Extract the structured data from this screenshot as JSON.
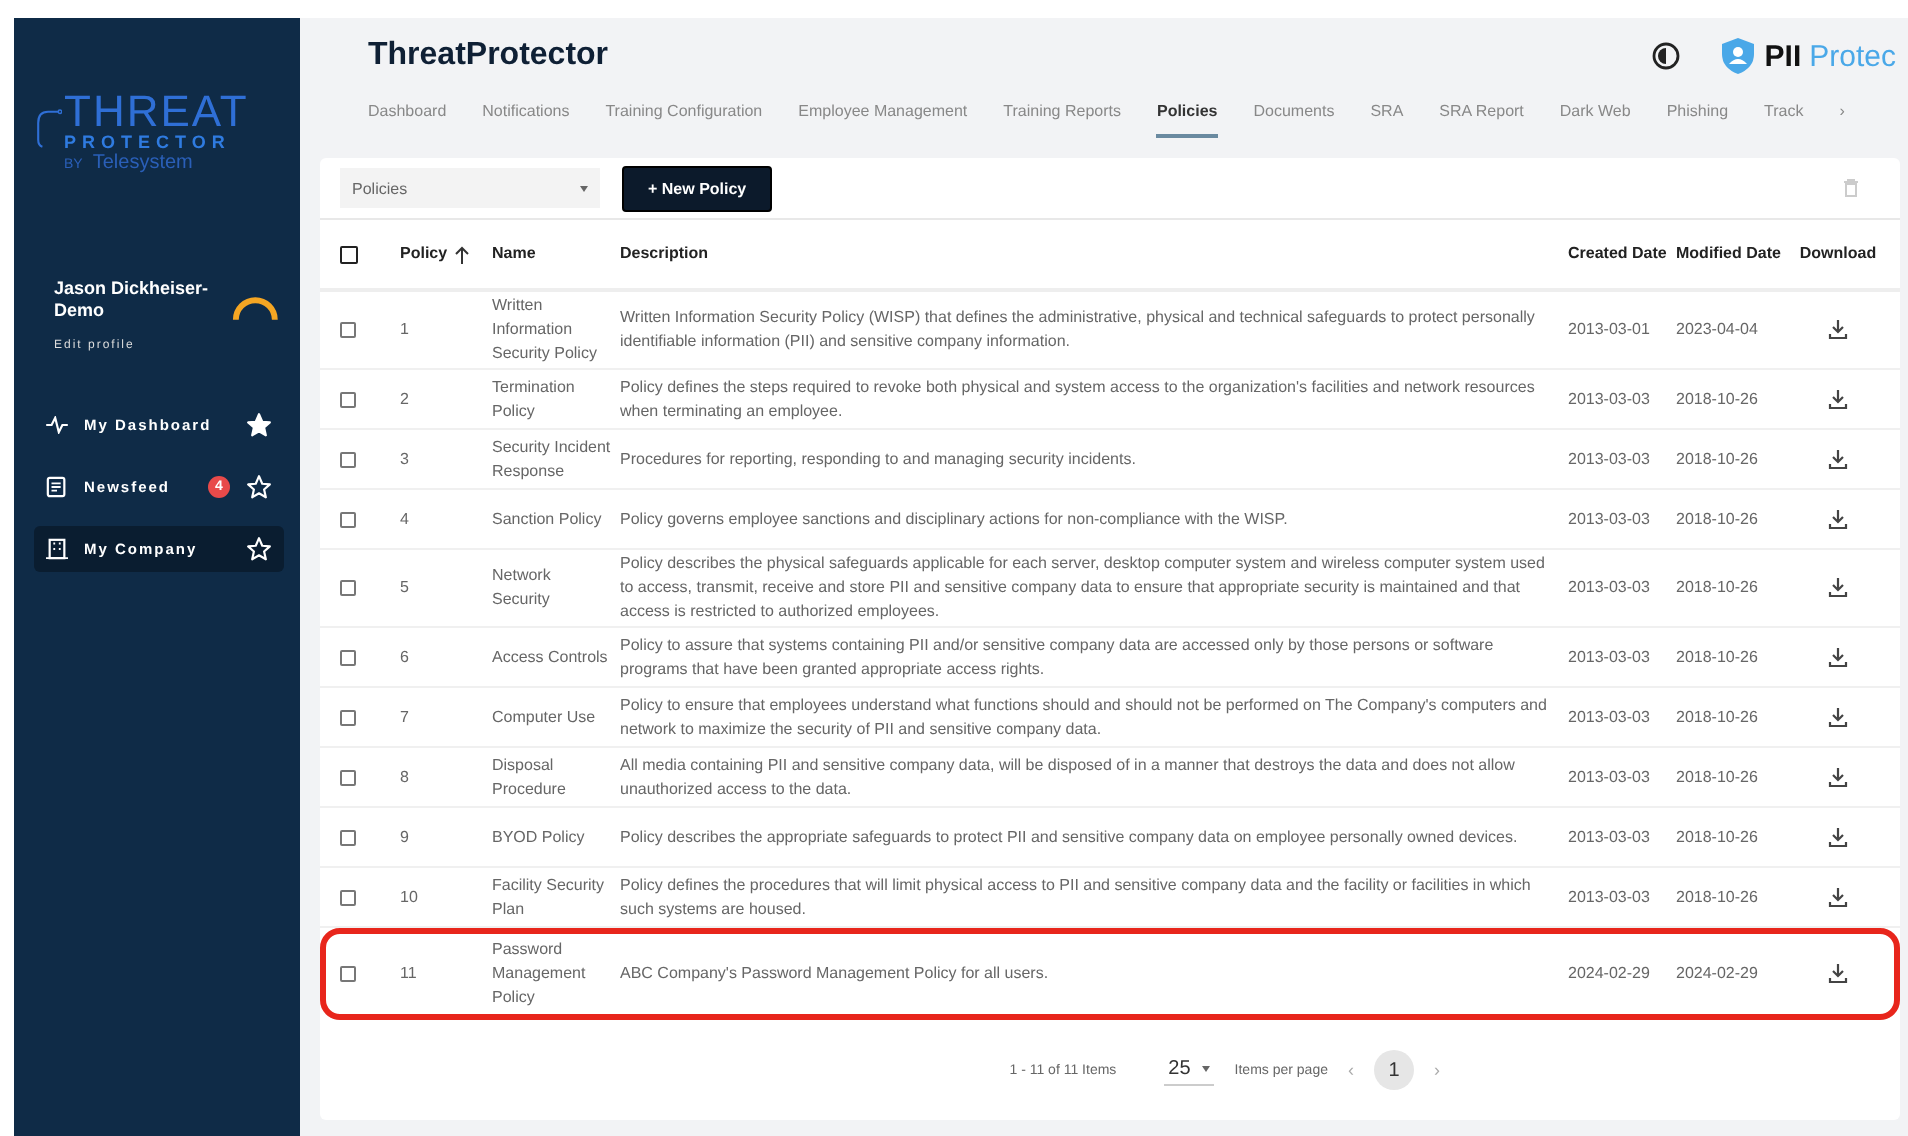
{
  "logo": {
    "line1": "THREAT",
    "line2": "PROTECTOR",
    "by": "BY",
    "brand": "Telesystem"
  },
  "user": {
    "name": "Jason Dickheiser-Demo",
    "edit": "Edit profile"
  },
  "nav": [
    {
      "label": "My Dashboard",
      "kind": "pulse",
      "selected": false,
      "starred": true
    },
    {
      "label": "Newsfeed",
      "kind": "news",
      "badge": "4",
      "selected": false,
      "starred": false
    },
    {
      "label": "My Company",
      "kind": "building",
      "selected": true,
      "starred": false
    }
  ],
  "header": {
    "title": "ThreatProtector",
    "brand_a": "PII",
    "brand_b": "Protec"
  },
  "tabs": [
    {
      "label": "Dashboard",
      "selected": false
    },
    {
      "label": "Notifications",
      "selected": false
    },
    {
      "label": "Training Configuration",
      "selected": false
    },
    {
      "label": "Employee Management",
      "selected": false
    },
    {
      "label": "Training Reports",
      "selected": false
    },
    {
      "label": "Policies",
      "selected": true
    },
    {
      "label": "Documents",
      "selected": false
    },
    {
      "label": "SRA",
      "selected": false
    },
    {
      "label": "SRA Report",
      "selected": false
    },
    {
      "label": "Dark Web",
      "selected": false
    },
    {
      "label": "Phishing",
      "selected": false
    },
    {
      "label": "Track",
      "selected": false
    }
  ],
  "tabs_more": "›",
  "toolbar": {
    "dropdown": "Policies",
    "new_button": "+ New Policy"
  },
  "table": {
    "all_checked": false,
    "columns": [
      "Policy",
      "Name",
      "Description",
      "Created Date",
      "Modified Date",
      "Download"
    ],
    "rows": [
      {
        "policy": "1",
        "name": "Written Information Security Policy",
        "description": "Written Information Security Policy (WISP) that defines the administrative, physical and technical safeguards to protect personally identifiable information (PII) and sensitive company information.",
        "created": "2013-03-01",
        "modified": "2023-04-04",
        "checked": false,
        "highlighted": false
      },
      {
        "policy": "2",
        "name": "Termination Policy",
        "description": "Policy defines the steps required to revoke both physical and system access to the organization's facilities and network resources when terminating an employee.",
        "created": "2013-03-03",
        "modified": "2018-10-26",
        "checked": false,
        "highlighted": false
      },
      {
        "policy": "3",
        "name": "Security Incident Response",
        "description": "Procedures for reporting, responding to and managing security incidents.",
        "created": "2013-03-03",
        "modified": "2018-10-26",
        "checked": false,
        "highlighted": false
      },
      {
        "policy": "4",
        "name": "Sanction Policy",
        "description": "Policy governs employee sanctions and disciplinary actions for non-compliance with the WISP.",
        "created": "2013-03-03",
        "modified": "2018-10-26",
        "checked": false,
        "highlighted": false
      },
      {
        "policy": "5",
        "name": "Network Security",
        "description": "Policy describes the physical safeguards applicable for each server, desktop computer system and wireless computer system used to access, transmit, receive and store PII and sensitive company data to ensure that appropriate security is maintained and that access is restricted to authorized employees.",
        "created": "2013-03-03",
        "modified": "2018-10-26",
        "checked": false,
        "highlighted": false
      },
      {
        "policy": "6",
        "name": "Access Controls",
        "description": "Policy to assure that systems containing PII and/or sensitive company data are accessed only by those persons or software programs that have been granted appropriate access rights.",
        "created": "2013-03-03",
        "modified": "2018-10-26",
        "checked": false,
        "highlighted": false
      },
      {
        "policy": "7",
        "name": "Computer Use",
        "description": "Policy to ensure that employees understand what functions should and should not be performed on The Company's computers and network to maximize the security of PII and sensitive company data.",
        "created": "2013-03-03",
        "modified": "2018-10-26",
        "checked": false,
        "highlighted": false
      },
      {
        "policy": "8",
        "name": "Disposal Procedure",
        "description": "All media containing PII and sensitive company data, will be disposed of in a manner that destroys the data and does not allow unauthorized access to the data.",
        "created": "2013-03-03",
        "modified": "2018-10-26",
        "checked": false,
        "highlighted": false
      },
      {
        "policy": "9",
        "name": "BYOD Policy",
        "description": "Policy describes the appropriate safeguards to protect PII and sensitive company data on employee personally owned devices.",
        "created": "2013-03-03",
        "modified": "2018-10-26",
        "checked": false,
        "highlighted": false
      },
      {
        "policy": "10",
        "name": "Facility Security Plan",
        "description": "Policy defines the procedures that will limit physical access to PII and sensitive company data and the facility or facilities in which such systems are housed.",
        "created": "2013-03-03",
        "modified": "2018-10-26",
        "checked": false,
        "highlighted": false
      },
      {
        "policy": "11",
        "name": "Password Management Policy",
        "description": "ABC Company's Password Management Policy for all users.",
        "created": "2024-02-29",
        "modified": "2024-02-29",
        "checked": false,
        "highlighted": true
      }
    ]
  },
  "pager": {
    "summary": "1 - 11 of 11 Items",
    "page_size": "25",
    "page_size_label": "Items per page",
    "prev": "‹",
    "pages": [
      {
        "label": "1",
        "selected": true
      }
    ],
    "next": "›"
  }
}
